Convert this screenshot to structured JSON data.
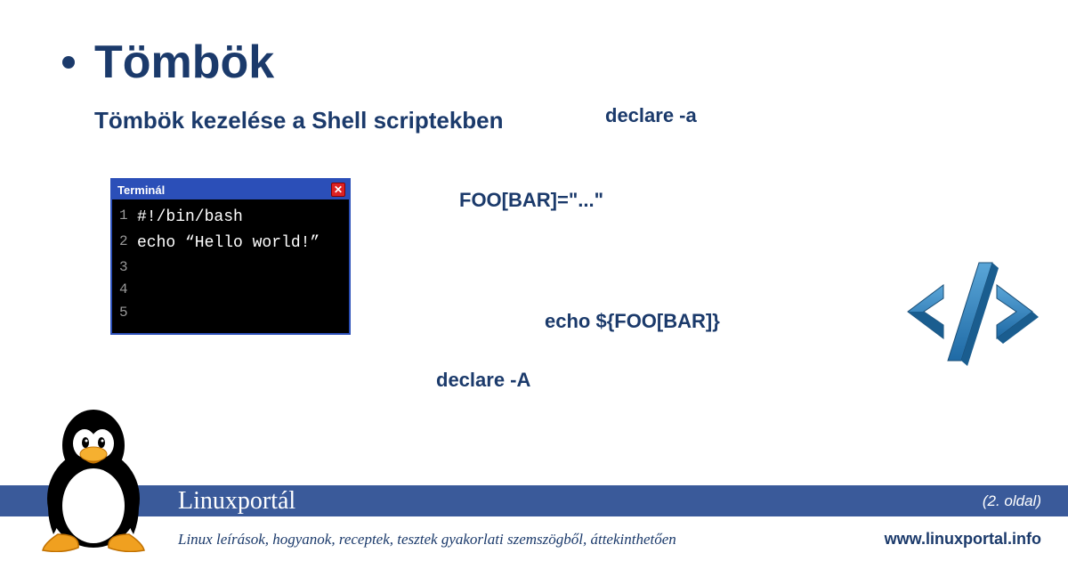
{
  "page": {
    "title": "Tömbök",
    "subtitle": "Tömbök kezelése a Shell scriptekben"
  },
  "snippets": {
    "s1": "declare -a",
    "s2": "FOO[BAR]=\"...\"",
    "s3": "echo ${FOO[BAR]}",
    "s4": "declare -A"
  },
  "terminal": {
    "title": "Terminál",
    "lines": [
      {
        "num": "1",
        "code": "#!/bin/bash"
      },
      {
        "num": "2",
        "code": "echo “Hello world!”"
      },
      {
        "num": "3",
        "code": ""
      },
      {
        "num": "4",
        "code": ""
      },
      {
        "num": "5",
        "code": ""
      }
    ]
  },
  "footer": {
    "brand": "Linuxportál",
    "page_label": "(2. oldal)",
    "tagline": "Linux leírások, hogyanok, receptek, tesztek gyakorlati szemszögből, áttekinthetően",
    "url": "www.linuxportal.info"
  }
}
